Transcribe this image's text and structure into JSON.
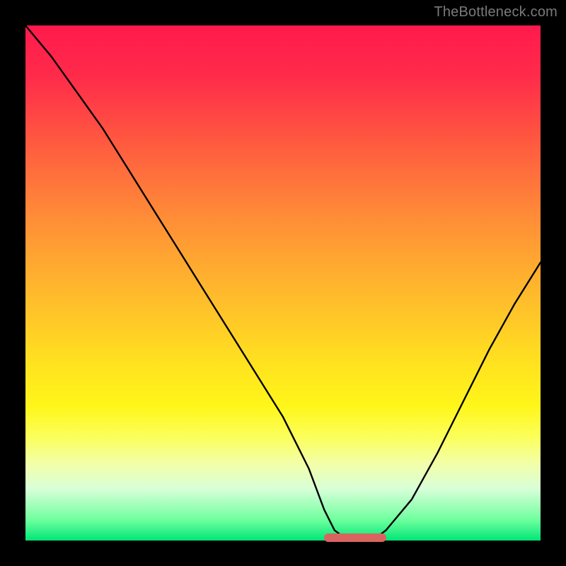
{
  "watermark": "TheBottleneck.com",
  "chart_data": {
    "type": "line",
    "title": "",
    "xlabel": "",
    "ylabel": "",
    "xlim": [
      0,
      100
    ],
    "ylim": [
      0,
      100
    ],
    "grid": false,
    "background": "red-yellow-green vertical gradient",
    "series": [
      {
        "name": "curve",
        "x": [
          0,
          5,
          10,
          15,
          20,
          25,
          30,
          35,
          40,
          45,
          50,
          55,
          58,
          60,
          62,
          64,
          66,
          68,
          70,
          75,
          80,
          85,
          90,
          95,
          100
        ],
        "y": [
          100,
          94,
          87,
          80,
          72,
          64,
          56,
          48,
          40,
          32,
          24,
          14,
          6,
          2,
          0.5,
          0,
          0,
          0.5,
          2,
          8,
          17,
          27,
          37,
          46,
          54
        ]
      }
    ],
    "highlight_bar": {
      "x_start": 58,
      "x_end": 70,
      "y": 0.5
    },
    "colors": {
      "curve": "#000000",
      "highlight_bar": "#d9645f",
      "gradient_top": "#ff1a4d",
      "gradient_bottom": "#00e676"
    }
  }
}
